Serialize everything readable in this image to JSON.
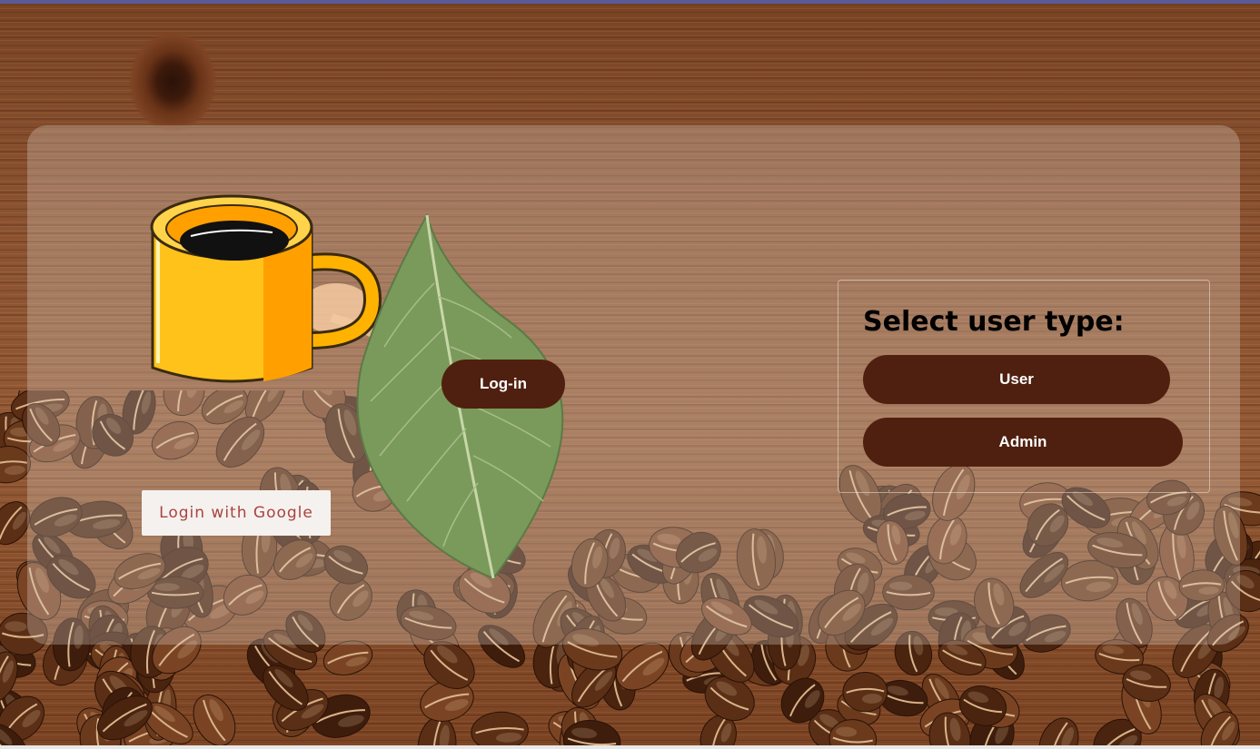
{
  "login": {
    "button_label": "Log-in"
  },
  "google": {
    "button_label": "Login with Google"
  },
  "user_type": {
    "title": "Select user type:",
    "options": [
      {
        "label": "User"
      },
      {
        "label": "Admin"
      }
    ]
  },
  "colors": {
    "button_bg": "#4f200f",
    "button_text": "#ffffff",
    "google_text": "#a8443f",
    "panel_overlay": "rgba(225,215,205,0.30)"
  },
  "icons": [
    "coffee-cup-icon",
    "coffee-leaf-icon",
    "coffee-beans-image",
    "wood-background-image"
  ]
}
